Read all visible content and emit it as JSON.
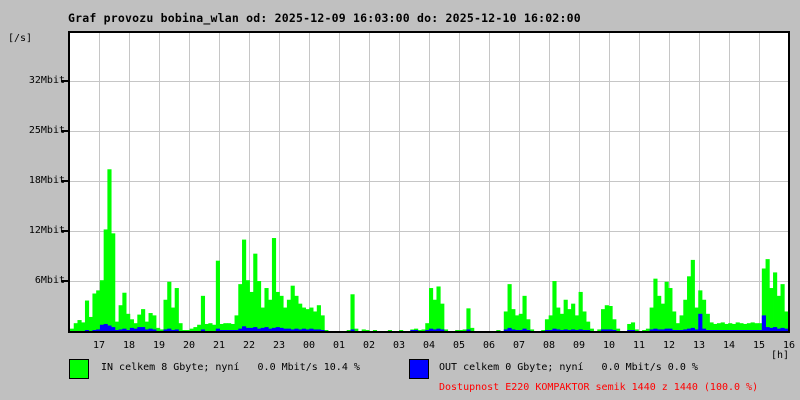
{
  "colors": {
    "background": "#c0c0c0",
    "plot_background": "#ffffff",
    "grid": "#c6c6c6",
    "in_series": "#00ff00",
    "out_series": "#0000ff",
    "availability_text": "#ff0000"
  },
  "legend": {
    "in": {
      "label": "IN celkem 8 Gbyte; nyní   0.0 Mbit/s 10.4 %",
      "color": "#00ff00"
    },
    "out": {
      "label": "OUT celkem 0 Gbyte; nyní   0.0 Mbit/s 0.0 %",
      "color": "#0000ff"
    }
  },
  "availability": {
    "text": "Dostupnost E220 KOMPAKTOR semik 1440 z 1440 (100.0 %)",
    "color": "#ff0000"
  },
  "chart_data": {
    "type": "area",
    "title": "Graf provozu bobina_wlan od: 2025-12-09 16:03:00 do: 2025-12-10 16:02:00",
    "ylabel": "[/s]",
    "xlabel": "[h]",
    "grid": true,
    "ylim_mbit": [
      0,
      38.4
    ],
    "y_tick_labels_top_down": [
      "32Mbit",
      "25Mbit",
      "18Mbit",
      "12Mbit",
      "6Mbit"
    ],
    "y_tick_values_mbit": [
      32.0,
      25.6,
      19.2,
      12.8,
      6.4
    ],
    "x_tick_labels": [
      "17",
      "18",
      "19",
      "20",
      "21",
      "22",
      "23",
      "00",
      "01",
      "02",
      "03",
      "04",
      "05",
      "06",
      "07",
      "08",
      "09",
      "10",
      "11",
      "12",
      "13",
      "14",
      "15",
      "16"
    ],
    "samples_per_hour": 8,
    "hours_span": 24,
    "unit": "Mbit/s",
    "series": [
      {
        "name": "IN",
        "color": "#00ff00",
        "values": [
          0.3,
          1.0,
          1.4,
          1.1,
          3.9,
          1.8,
          4.8,
          5.2,
          6.5,
          13.0,
          20.7,
          12.5,
          1.2,
          3.3,
          4.9,
          2.2,
          1.5,
          1.0,
          2.1,
          2.8,
          1.2,
          2.3,
          2.0,
          0.4,
          0.2,
          4.0,
          6.3,
          3.0,
          5.5,
          1.0,
          0.1,
          0.1,
          0.3,
          0.5,
          0.8,
          4.5,
          0.9,
          1.0,
          0.8,
          9.0,
          0.9,
          1.0,
          1.0,
          0.9,
          2.0,
          6.0,
          11.7,
          6.5,
          5.0,
          9.9,
          6.4,
          3.0,
          5.5,
          4.0,
          11.9,
          5.0,
          4.5,
          3.0,
          4.0,
          5.8,
          4.5,
          3.5,
          3.0,
          2.8,
          3.0,
          2.5,
          3.3,
          2.0,
          0.1,
          0.0,
          0.0,
          0.0,
          0.0,
          0.0,
          0.1,
          4.7,
          0.3,
          0.0,
          0.2,
          0.1,
          0.0,
          0.1,
          0.0,
          0.0,
          0.0,
          0.1,
          0.0,
          0.0,
          0.1,
          0.0,
          0.0,
          0.2,
          0.3,
          0.1,
          0.2,
          1.0,
          5.5,
          4.0,
          5.7,
          3.5,
          0.2,
          0.0,
          0.0,
          0.1,
          0.1,
          0.2,
          2.9,
          0.4,
          0.0,
          0.0,
          0.0,
          0.0,
          0.0,
          0.0,
          0.1,
          0.0,
          2.5,
          6.0,
          2.8,
          2.0,
          2.2,
          4.5,
          1.5,
          0.2,
          0.0,
          0.0,
          0.1,
          1.5,
          2.0,
          6.4,
          3.0,
          2.2,
          4.0,
          2.8,
          3.5,
          2.0,
          5.0,
          2.5,
          1.2,
          0.3,
          0.0,
          0.2,
          2.8,
          3.3,
          3.2,
          1.5,
          0.3,
          0.0,
          0.0,
          0.9,
          1.1,
          0.2,
          0.0,
          0.1,
          0.3,
          3.0,
          6.7,
          4.5,
          3.5,
          6.3,
          5.5,
          2.5,
          1.0,
          2.0,
          4.0,
          7.0,
          9.1,
          3.0,
          5.2,
          4.0,
          2.2,
          1.1,
          0.9,
          1.0,
          1.1,
          0.9,
          1.0,
          0.9,
          1.1,
          1.0,
          0.9,
          1.0,
          1.1,
          1.0,
          1.0,
          8.0,
          9.2,
          5.5,
          7.5,
          4.5,
          6.0,
          2.5
        ]
      },
      {
        "name": "OUT",
        "color": "#0000ff",
        "values": [
          0,
          0,
          0,
          0,
          0.1,
          0,
          0.1,
          0.2,
          0.8,
          0.9,
          0.7,
          0.5,
          0.1,
          0.2,
          0.3,
          0.1,
          0.4,
          0.3,
          0.5,
          0.5,
          0.2,
          0.3,
          0.2,
          0,
          0,
          0.2,
          0.3,
          0.1,
          0.2,
          0,
          0,
          0,
          0,
          0,
          0,
          0.2,
          0,
          0,
          0,
          0.3,
          0.1,
          0.1,
          0.1,
          0.1,
          0.1,
          0.3,
          0.6,
          0.4,
          0.4,
          0.5,
          0.3,
          0.4,
          0.5,
          0.3,
          0.4,
          0.5,
          0.4,
          0.3,
          0.3,
          0.2,
          0.3,
          0.2,
          0.3,
          0.2,
          0.3,
          0.2,
          0.2,
          0.1,
          0,
          0,
          0,
          0,
          0,
          0,
          0,
          0.2,
          0,
          0,
          0,
          0,
          0,
          0,
          0,
          0,
          0,
          0,
          0,
          0,
          0,
          0,
          0,
          0.1,
          0.1,
          0,
          0,
          0.1,
          0.3,
          0.2,
          0.3,
          0.2,
          0,
          0,
          0,
          0,
          0,
          0,
          0.2,
          0,
          0,
          0,
          0,
          0,
          0,
          0,
          0,
          0,
          0.2,
          0.4,
          0.2,
          0.1,
          0.1,
          0.3,
          0.1,
          0,
          0,
          0,
          0,
          0.1,
          0.1,
          0.3,
          0.2,
          0.1,
          0.2,
          0.1,
          0.2,
          0.1,
          0.2,
          0.1,
          0.1,
          0,
          0,
          0,
          0.2,
          0.2,
          0.2,
          0.1,
          0,
          0,
          0,
          0.1,
          0.1,
          0,
          0,
          0,
          0,
          0.2,
          0.3,
          0.2,
          0.2,
          0.3,
          0.3,
          0.1,
          0.1,
          0.1,
          0.2,
          0.3,
          0.4,
          0.2,
          2.2,
          0.3,
          0.1,
          0.1,
          0.1,
          0.1,
          0.1,
          0.1,
          0.1,
          0.1,
          0.1,
          0.1,
          0.1,
          0.1,
          0.1,
          0.1,
          0.1,
          2.0,
          0.5,
          0.4,
          0.5,
          0.3,
          0.4,
          0.3
        ]
      }
    ]
  }
}
